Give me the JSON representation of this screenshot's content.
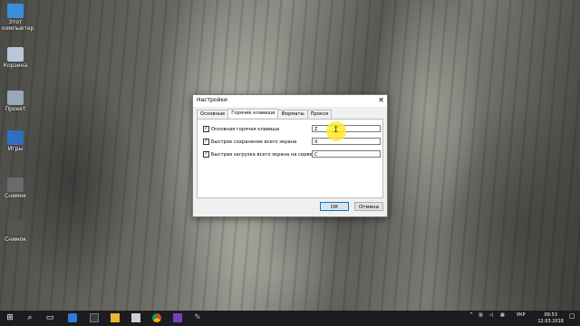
{
  "desktop": {
    "icons": [
      {
        "label": "Этот компьютер",
        "icon": "computer-icon",
        "color": "#3a8fd8"
      },
      {
        "label": "Корзина",
        "icon": "recycle-bin-icon",
        "color": "#b8c8d8"
      },
      {
        "label": "Проект",
        "icon": "project-icon",
        "color": "#9aa7b4"
      },
      {
        "label": "Игры",
        "icon": "games-icon",
        "color": "#2f6fc1"
      },
      {
        "label": "Снимок",
        "icon": "snapshot-icon",
        "color": "#6a6a6a"
      },
      {
        "label": "Снимок",
        "icon": "snapshot-icon",
        "color": "#555555"
      }
    ]
  },
  "dialog": {
    "title": "Настройки",
    "close": "✕",
    "tabs": [
      "Основные",
      "Горячие клавиши",
      "Форматы",
      "Прокси"
    ],
    "active_tab": "Горячие клавиши",
    "rows": [
      {
        "label": "Основная горячая клавиша",
        "checked": true,
        "value": "Z"
      },
      {
        "label": "Быстрое сохранение всего экрана",
        "checked": true,
        "value": "X"
      },
      {
        "label": "Быстрая загрузка всего экрана на сервер",
        "checked": true,
        "value": "C"
      }
    ],
    "checkmark": "✓",
    "ok_label": "ОК",
    "cancel_label": "Отмена"
  },
  "taskbar": {
    "start": "⊞",
    "search": "⌕",
    "task_view": "▭",
    "apps": [
      "edge-icon",
      "store-icon",
      "explorer-icon",
      "mail-icon",
      "chrome-icon",
      "onenote-icon",
      "feather-icon"
    ],
    "tray_lang": "УКР",
    "time": "09:53",
    "date": "12.03.2018"
  },
  "colors": {
    "accent": "#0078d7",
    "highlight": "#ffeb28",
    "taskbar": "#1c1c1e"
  }
}
